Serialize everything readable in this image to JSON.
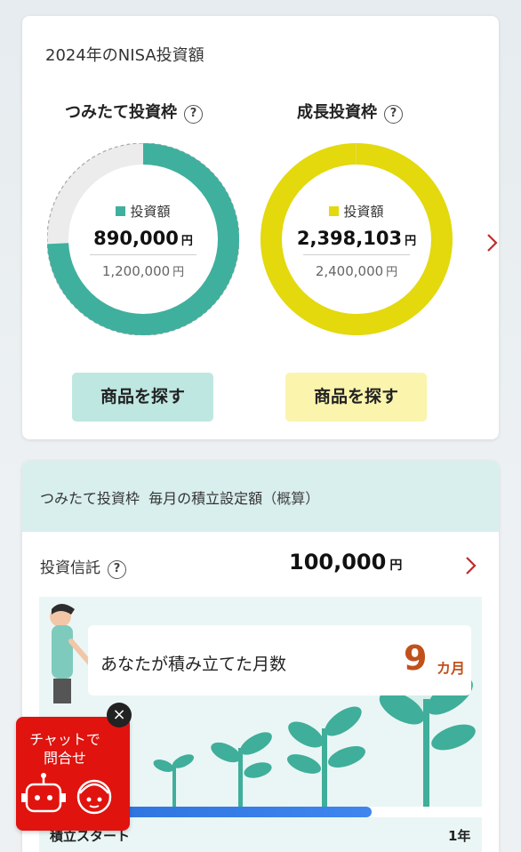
{
  "summary": {
    "title": "2024年のNISA投資額",
    "tsumitate": {
      "title": "つみたて投資枠",
      "legend": "投資額",
      "amount": "890,000",
      "unit": "円",
      "limit": "1,200,000",
      "limit_unit": "円",
      "invested_fraction": 0.7417,
      "color": "#3fb09e",
      "button": "商品を探す"
    },
    "growth": {
      "title": "成長投資枠",
      "legend": "投資額",
      "amount": "2,398,103",
      "unit": "円",
      "limit": "2,400,000",
      "limit_unit": "円",
      "invested_fraction": 0.9992,
      "color": "#e3d90c",
      "button": "商品を探す"
    },
    "help_glyph": "?"
  },
  "monthly": {
    "title": "つみたて投資枠  毎月の積立設定額",
    "title_suffix": "（概算）",
    "fund_label": "投資信託",
    "fund_amount": "100,000",
    "fund_unit": "円",
    "months_label": "あなたが積み立てた月数",
    "months_value": "9",
    "months_unit": "カ月",
    "progress_fraction": 0.75,
    "start_label": "積立スタート",
    "end_label": "1年"
  },
  "chat": {
    "line1": "チャットで",
    "line2": "問合せ",
    "close_glyph": "×"
  },
  "icons": {
    "help": "question-circle-icon",
    "next": "chevron-right-icon",
    "close": "close-icon",
    "bot": "robot-icon",
    "operator": "operator-icon"
  },
  "colors": {
    "accent_red": "#c12a2a",
    "months_orange": "#c1511c",
    "header_teal": "#d9efee",
    "progress_blue": "#2a6fdb"
  }
}
